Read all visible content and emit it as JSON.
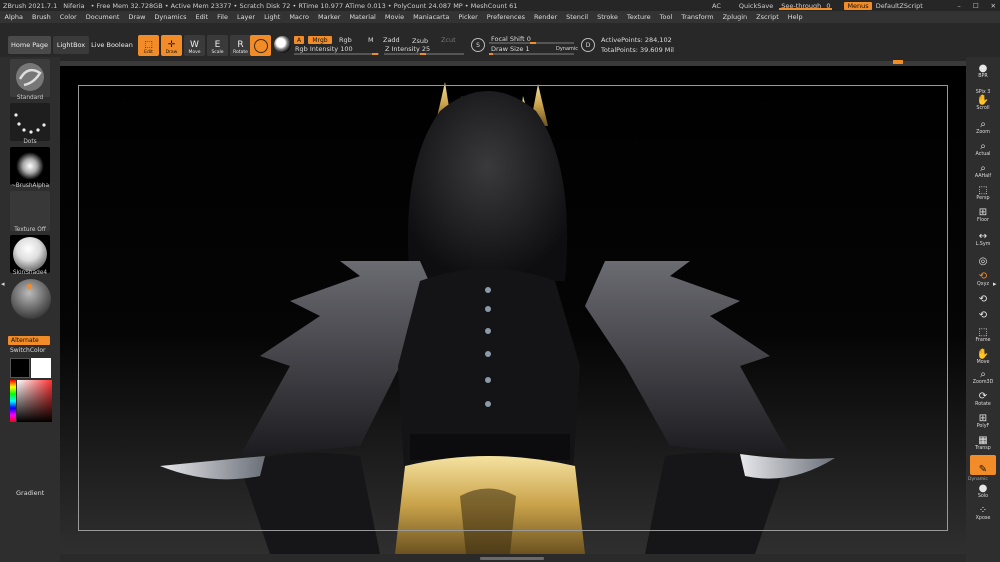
{
  "titlebar": {
    "app": "ZBrush 2021.7.1",
    "document": "Niferia",
    "stats": "• Free Mem 32.728GB • Active Mem 23377 • Scratch Disk 72 • RTime 10.977 ATime 0.013 • PolyCount 24.087 MP • MeshCount 61",
    "ac_label": "AC",
    "quicksave_label": "QuickSave",
    "see_through_label": "See-through",
    "see_through_value": "0",
    "menus_label": "Menus",
    "script_label": "DefaultZScript",
    "minimize": "–",
    "maximize": "☐",
    "close": "✕"
  },
  "menubar": [
    "Alpha",
    "Brush",
    "Color",
    "Document",
    "Draw",
    "Dynamics",
    "Edit",
    "File",
    "Layer",
    "Light",
    "Macro",
    "Marker",
    "Material",
    "Movie",
    "Maniacarta",
    "Picker",
    "Preferences",
    "Render",
    "Stencil",
    "Stroke",
    "Texture",
    "Tool",
    "Transform",
    "Zplugin",
    "Zscript",
    "Help"
  ],
  "top_left": {
    "home_page": "Home Page",
    "lightbox": "LightBox",
    "live_boolean": "Live Boolean"
  },
  "tools": [
    {
      "label": "Edit",
      "icon": "edit-icon",
      "glyph": "⬚",
      "active": true
    },
    {
      "label": "Draw",
      "icon": "draw-icon",
      "glyph": "✛",
      "active": true
    },
    {
      "label": "Move",
      "icon": "move-icon",
      "glyph": "W",
      "active": false
    },
    {
      "label": "Scale",
      "icon": "scale-icon",
      "glyph": "E",
      "active": false
    },
    {
      "label": "Rotate",
      "icon": "rotate-icon",
      "glyph": "R",
      "active": false
    }
  ],
  "draw_settings": {
    "a_label": "A",
    "mrgb": "Mrgb",
    "rgb": "Rgb",
    "m": "M",
    "rgb_intensity": "Rgb Intensity 100",
    "zadd": "Zadd",
    "zsub": "Zsub",
    "zcut": "Zcut",
    "z_intensity": "Z Intensity 25",
    "focal_shift": "Focal Shift 0",
    "draw_size": "Draw Size 1",
    "dynamic": "Dynamic",
    "s_label": "S",
    "d_label": "D",
    "active_points": "ActivePoints: 284,102",
    "total_points": "TotalPoints: 39.609 Mil",
    "accent": "#f28c28"
  },
  "left_shelf": {
    "brush": "Standard",
    "stroke": "Dots",
    "alpha": "~BrushAlpha",
    "texture": "Texture Off",
    "material": "SkinShade4",
    "alternate": "Alternate",
    "switch_color": "SwitchColor",
    "gradient": "Gradient"
  },
  "right_shelf": [
    {
      "label": "BPR",
      "icon": "bpr-icon",
      "glyph": "●"
    },
    {
      "label": "SPix 3",
      "icon": "spix-icon",
      "glyph": ""
    },
    {
      "label": "Scroll",
      "icon": "scroll-icon",
      "glyph": "✋"
    },
    {
      "label": "Zoom",
      "icon": "zoom-icon",
      "glyph": "⌕"
    },
    {
      "label": "Actual",
      "icon": "actual-icon",
      "glyph": "⌕"
    },
    {
      "label": "AAHalf",
      "icon": "aahalf-icon",
      "glyph": "⌕"
    },
    {
      "label": "Persp",
      "icon": "persp-icon",
      "glyph": "⬚"
    },
    {
      "label": "Floor",
      "icon": "floor-icon",
      "glyph": "⊞"
    },
    {
      "label": "L.Sym",
      "icon": "lsym-icon",
      "glyph": "↔"
    },
    {
      "label": "",
      "icon": "local-icon",
      "glyph": "◎"
    },
    {
      "label": "Qxyz",
      "icon": "xyz-icon",
      "glyph": "⟲",
      "active": true
    },
    {
      "label": "",
      "icon": "y-rotate-icon",
      "glyph": "⟲"
    },
    {
      "label": "",
      "icon": "z-rotate-icon",
      "glyph": "⟲"
    },
    {
      "label": "Frame",
      "icon": "frame-icon",
      "glyph": "⬚"
    },
    {
      "label": "Move",
      "icon": "move-view-icon",
      "glyph": "✋"
    },
    {
      "label": "Zoom3D",
      "icon": "zoom3d-icon",
      "glyph": "⌕"
    },
    {
      "label": "Rotate",
      "icon": "rotate-view-icon",
      "glyph": "⟳"
    },
    {
      "label": "PolyF",
      "icon": "polyf-icon",
      "glyph": "⊞"
    },
    {
      "label": "Transp",
      "icon": "transp-icon",
      "glyph": "▦"
    },
    {
      "label": "",
      "icon": "ghost-icon",
      "glyph": "✎",
      "active": true,
      "bg": true
    },
    {
      "label": "Solo",
      "icon": "solo-icon",
      "glyph": "●"
    },
    {
      "label": "Xpose",
      "icon": "xpose-icon",
      "glyph": "⁘"
    }
  ],
  "dynamic_label": "Dynamic"
}
